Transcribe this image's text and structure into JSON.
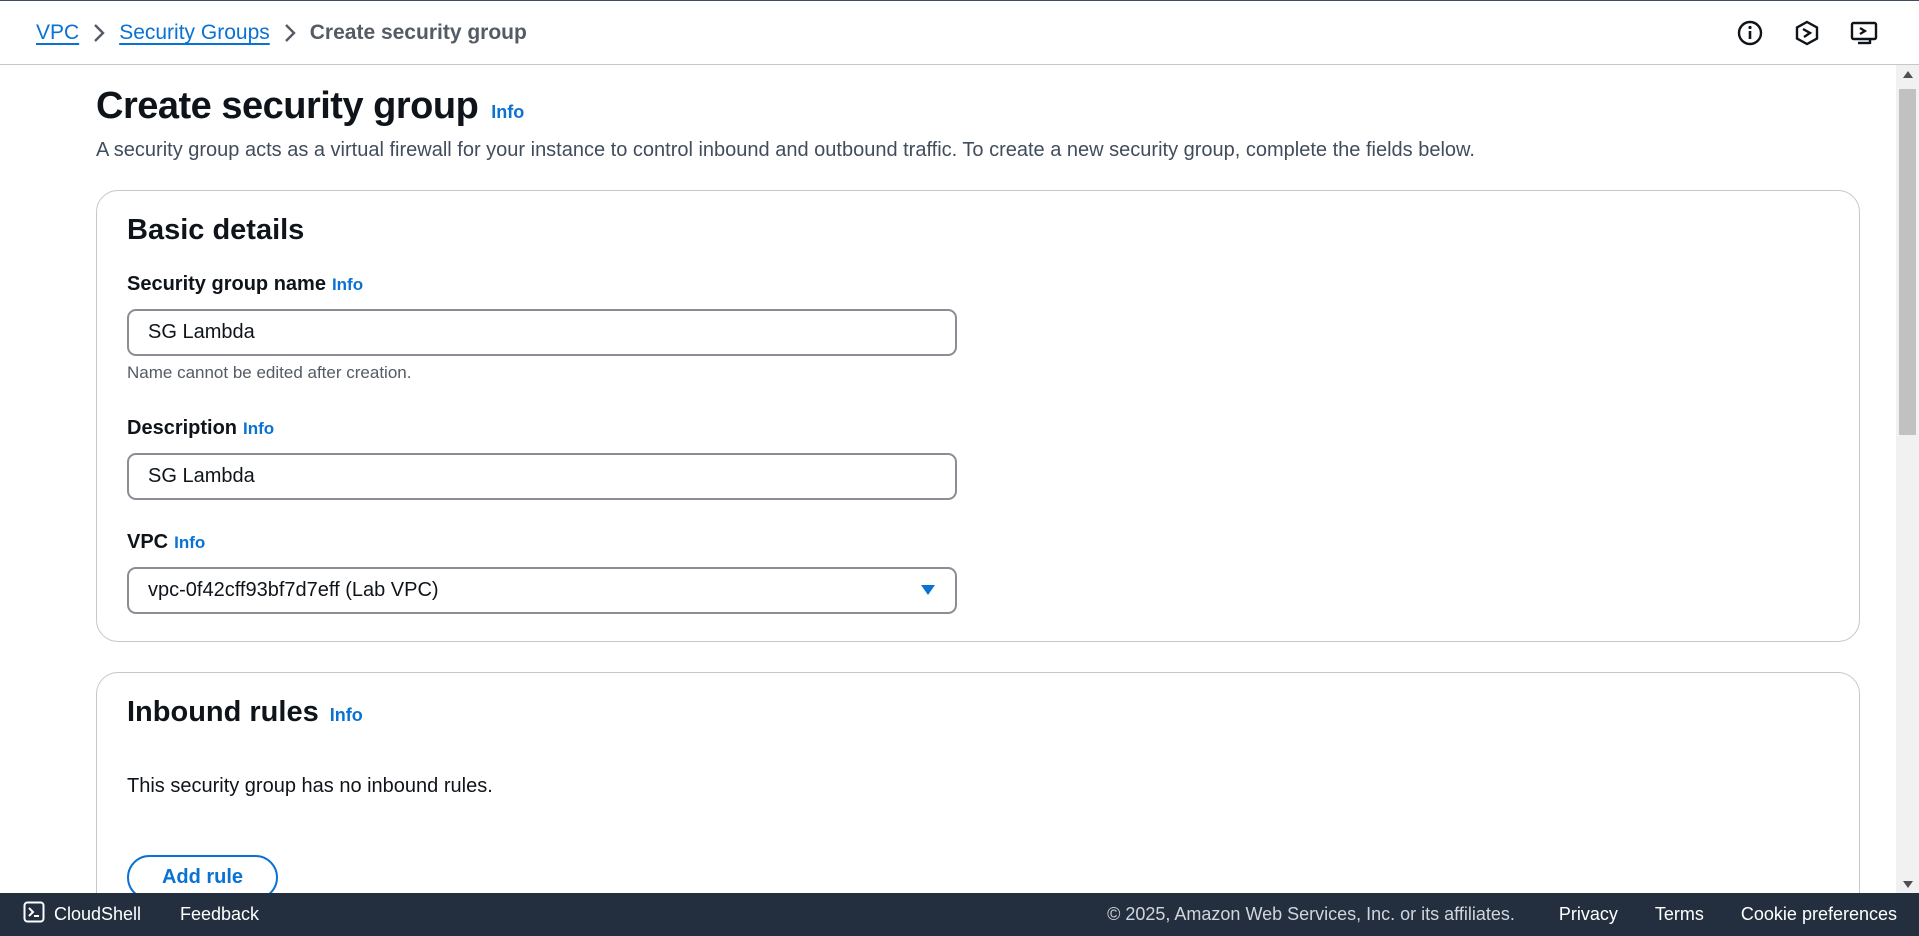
{
  "breadcrumb": {
    "items": [
      {
        "label": "VPC"
      },
      {
        "label": "Security Groups"
      }
    ],
    "current": "Create security group"
  },
  "header_icons": [
    "info-circle-icon",
    "notifications-icon",
    "screen-share-icon"
  ],
  "page": {
    "title": "Create security group",
    "title_info": "Info",
    "description": "A security group acts as a virtual firewall for your instance to control inbound and outbound traffic. To create a new security group, complete the fields below."
  },
  "basic_details": {
    "title": "Basic details",
    "name_label": "Security group name",
    "name_info": "Info",
    "name_value": "SG Lambda",
    "name_hint": "Name cannot be edited after creation.",
    "description_label": "Description",
    "description_info": "Info",
    "description_value": "SG Lambda",
    "vpc_label": "VPC",
    "vpc_info": "Info",
    "vpc_value": "vpc-0f42cff93bf7d7eff (Lab VPC)"
  },
  "inbound_rules": {
    "title": "Inbound rules",
    "info": "Info",
    "empty_text": "This security group has no inbound rules.",
    "add_rule_label": "Add rule"
  },
  "footer": {
    "cloudshell_label": "CloudShell",
    "feedback_label": "Feedback",
    "copyright": "© 2025, Amazon Web Services, Inc. or its affiliates.",
    "links": [
      "Privacy",
      "Terms",
      "Cookie preferences"
    ]
  },
  "colors": {
    "link": "#0972d3",
    "footer_bg": "#232f3e",
    "border": "#c6c6cd",
    "input_border": "#8c8c94"
  }
}
